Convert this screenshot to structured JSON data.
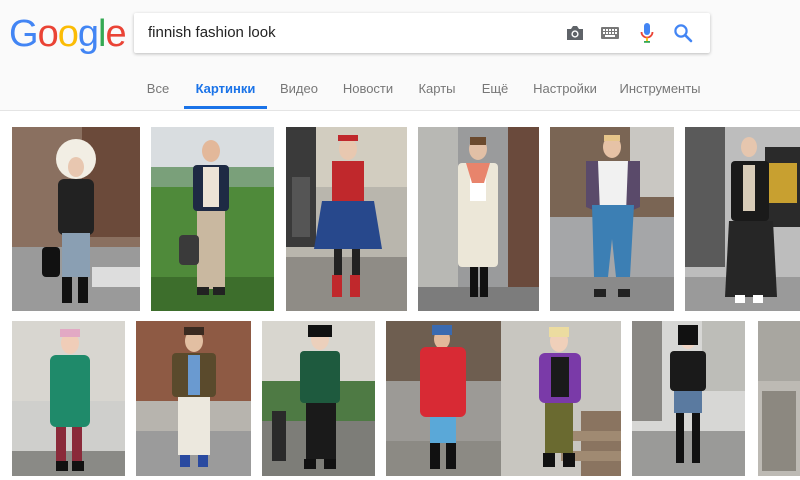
{
  "logo": {
    "letters": [
      "G",
      "o",
      "o",
      "g",
      "l",
      "e"
    ],
    "colors": [
      "#4285f4",
      "#ea4335",
      "#fbbc05",
      "#4285f4",
      "#34a853",
      "#ea4335"
    ]
  },
  "search": {
    "query": "finnish fashion look"
  },
  "tabs": [
    {
      "label": "Все"
    },
    {
      "label": "Картинки"
    },
    {
      "label": "Видео"
    },
    {
      "label": "Новости"
    },
    {
      "label": "Карты"
    },
    {
      "label": "Ещё"
    },
    {
      "label": "Настройки"
    },
    {
      "label": "Инструменты"
    }
  ],
  "icons": {
    "camera": "camera-icon",
    "keyboard": "keyboard-icon",
    "mic": "microphone-icon",
    "search": "search-icon"
  },
  "colors": {
    "accent": "#1a73e8",
    "tab_text": "#777777"
  }
}
